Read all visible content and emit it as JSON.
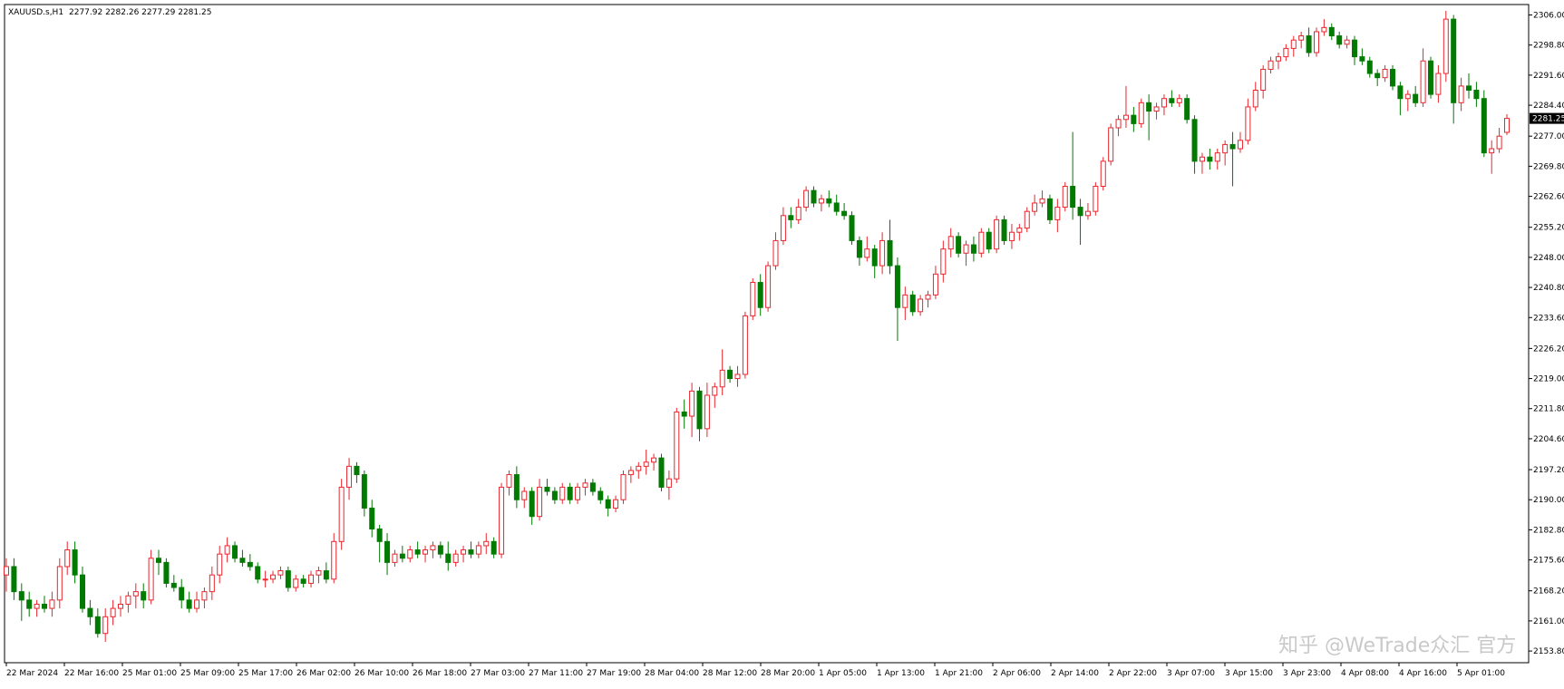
{
  "header": {
    "symbol": "XAUUSD.s,H1",
    "ohlc": "2277.92 2282.26 2277.29 2281.25"
  },
  "price_tag": "2281.25",
  "watermark": "知乎 @WeTrade众汇 官方",
  "colors": {
    "up": "#e8262e",
    "down": "#007a00",
    "axis": "#000000",
    "tag_bg": "#000000",
    "tag_fg": "#ffffff"
  },
  "chart_data": {
    "type": "candlestick",
    "symbol": "XAUUSD.s",
    "timeframe": "H1",
    "ylim": [
      2151.0,
      2308.5
    ],
    "y_ticks": [
      "2306.00",
      "2298.80",
      "2291.60",
      "2284.40",
      "2277.00",
      "2269.80",
      "2262.60",
      "2255.20",
      "2248.00",
      "2240.80",
      "2233.60",
      "2226.20",
      "2219.00",
      "2211.80",
      "2204.60",
      "2197.20",
      "2190.00",
      "2182.80",
      "2175.60",
      "2168.20",
      "2161.00",
      "2153.80"
    ],
    "x_ticks": [
      "22 Mar 2024",
      "22 Mar 16:00",
      "25 Mar 01:00",
      "25 Mar 09:00",
      "25 Mar 17:00",
      "26 Mar 02:00",
      "26 Mar 10:00",
      "26 Mar 18:00",
      "27 Mar 03:00",
      "27 Mar 11:00",
      "27 Mar 19:00",
      "28 Mar 04:00",
      "28 Mar 12:00",
      "28 Mar 20:00",
      "1 Apr 05:00",
      "1 Apr 13:00",
      "1 Apr 21:00",
      "2 Apr 06:00",
      "2 Apr 14:00",
      "2 Apr 22:00",
      "3 Apr 07:00",
      "3 Apr 15:00",
      "3 Apr 23:00",
      "4 Apr 08:00",
      "4 Apr 16:00",
      "5 Apr 01:00"
    ],
    "candles": [
      {
        "o": 2172,
        "h": 2176,
        "l": 2168,
        "c": 2174
      },
      {
        "o": 2174,
        "h": 2176,
        "l": 2166,
        "c": 2168
      },
      {
        "o": 2168,
        "h": 2170,
        "l": 2161,
        "c": 2166
      },
      {
        "o": 2166,
        "h": 2168,
        "l": 2162,
        "c": 2164
      },
      {
        "o": 2164,
        "h": 2166,
        "l": 2162,
        "c": 2165
      },
      {
        "o": 2165,
        "h": 2167,
        "l": 2163,
        "c": 2164
      },
      {
        "o": 2164,
        "h": 2168,
        "l": 2162,
        "c": 2166
      },
      {
        "o": 2166,
        "h": 2176,
        "l": 2164,
        "c": 2174
      },
      {
        "o": 2174,
        "h": 2180,
        "l": 2172,
        "c": 2178
      },
      {
        "o": 2178,
        "h": 2180,
        "l": 2170,
        "c": 2172
      },
      {
        "o": 2172,
        "h": 2174,
        "l": 2163,
        "c": 2164
      },
      {
        "o": 2164,
        "h": 2166,
        "l": 2160,
        "c": 2162
      },
      {
        "o": 2162,
        "h": 2164,
        "l": 2157,
        "c": 2158
      },
      {
        "o": 2158,
        "h": 2164,
        "l": 2156,
        "c": 2162
      },
      {
        "o": 2162,
        "h": 2166,
        "l": 2160,
        "c": 2164
      },
      {
        "o": 2164,
        "h": 2167,
        "l": 2162,
        "c": 2165
      },
      {
        "o": 2165,
        "h": 2168,
        "l": 2163,
        "c": 2167
      },
      {
        "o": 2167,
        "h": 2170,
        "l": 2164,
        "c": 2168
      },
      {
        "o": 2168,
        "h": 2170,
        "l": 2164,
        "c": 2166
      },
      {
        "o": 2166,
        "h": 2178,
        "l": 2165,
        "c": 2176
      },
      {
        "o": 2176,
        "h": 2178,
        "l": 2172,
        "c": 2175
      },
      {
        "o": 2175,
        "h": 2176,
        "l": 2169,
        "c": 2170
      },
      {
        "o": 2170,
        "h": 2172,
        "l": 2168,
        "c": 2169
      },
      {
        "o": 2169,
        "h": 2171,
        "l": 2164,
        "c": 2166
      },
      {
        "o": 2166,
        "h": 2168,
        "l": 2163,
        "c": 2164
      },
      {
        "o": 2164,
        "h": 2168,
        "l": 2163,
        "c": 2166
      },
      {
        "o": 2166,
        "h": 2169,
        "l": 2164,
        "c": 2168
      },
      {
        "o": 2168,
        "h": 2174,
        "l": 2166,
        "c": 2172
      },
      {
        "o": 2172,
        "h": 2179,
        "l": 2170,
        "c": 2177
      },
      {
        "o": 2177,
        "h": 2181,
        "l": 2175,
        "c": 2179
      },
      {
        "o": 2179,
        "h": 2180,
        "l": 2175,
        "c": 2176
      },
      {
        "o": 2176,
        "h": 2178,
        "l": 2174,
        "c": 2175
      },
      {
        "o": 2175,
        "h": 2177,
        "l": 2173,
        "c": 2174
      },
      {
        "o": 2174,
        "h": 2175,
        "l": 2170,
        "c": 2171
      },
      {
        "o": 2171,
        "h": 2173,
        "l": 2169,
        "c": 2171
      },
      {
        "o": 2171,
        "h": 2173,
        "l": 2170,
        "c": 2172
      },
      {
        "o": 2172,
        "h": 2174,
        "l": 2171,
        "c": 2173
      },
      {
        "o": 2173,
        "h": 2174,
        "l": 2168,
        "c": 2169
      },
      {
        "o": 2169,
        "h": 2172,
        "l": 2168,
        "c": 2171
      },
      {
        "o": 2171,
        "h": 2172,
        "l": 2169,
        "c": 2170
      },
      {
        "o": 2170,
        "h": 2173,
        "l": 2169,
        "c": 2172
      },
      {
        "o": 2172,
        "h": 2174,
        "l": 2170,
        "c": 2173
      },
      {
        "o": 2173,
        "h": 2175,
        "l": 2170,
        "c": 2171
      },
      {
        "o": 2171,
        "h": 2182,
        "l": 2170,
        "c": 2180
      },
      {
        "o": 2180,
        "h": 2195,
        "l": 2178,
        "c": 2193
      },
      {
        "o": 2193,
        "h": 2200,
        "l": 2190,
        "c": 2198
      },
      {
        "o": 2198,
        "h": 2199,
        "l": 2194,
        "c": 2196
      },
      {
        "o": 2196,
        "h": 2197,
        "l": 2186,
        "c": 2188
      },
      {
        "o": 2188,
        "h": 2190,
        "l": 2181,
        "c": 2183
      },
      {
        "o": 2183,
        "h": 2184,
        "l": 2175,
        "c": 2180
      },
      {
        "o": 2180,
        "h": 2182,
        "l": 2172,
        "c": 2175
      },
      {
        "o": 2175,
        "h": 2178,
        "l": 2174,
        "c": 2177
      },
      {
        "o": 2177,
        "h": 2179,
        "l": 2175,
        "c": 2176
      },
      {
        "o": 2176,
        "h": 2179,
        "l": 2175,
        "c": 2178
      },
      {
        "o": 2178,
        "h": 2180,
        "l": 2176,
        "c": 2177
      },
      {
        "o": 2177,
        "h": 2179,
        "l": 2175,
        "c": 2178
      },
      {
        "o": 2178,
        "h": 2180,
        "l": 2176,
        "c": 2179
      },
      {
        "o": 2179,
        "h": 2180,
        "l": 2176,
        "c": 2177
      },
      {
        "o": 2177,
        "h": 2180,
        "l": 2173,
        "c": 2175
      },
      {
        "o": 2175,
        "h": 2178,
        "l": 2174,
        "c": 2177
      },
      {
        "o": 2177,
        "h": 2179,
        "l": 2175,
        "c": 2178
      },
      {
        "o": 2178,
        "h": 2180,
        "l": 2176,
        "c": 2177
      },
      {
        "o": 2177,
        "h": 2180,
        "l": 2176,
        "c": 2179
      },
      {
        "o": 2179,
        "h": 2182,
        "l": 2177,
        "c": 2180
      },
      {
        "o": 2180,
        "h": 2181,
        "l": 2176,
        "c": 2177
      },
      {
        "o": 2177,
        "h": 2194,
        "l": 2176,
        "c": 2193
      },
      {
        "o": 2193,
        "h": 2197,
        "l": 2191,
        "c": 2196
      },
      {
        "o": 2196,
        "h": 2198,
        "l": 2188,
        "c": 2190
      },
      {
        "o": 2190,
        "h": 2193,
        "l": 2188,
        "c": 2192
      },
      {
        "o": 2192,
        "h": 2193,
        "l": 2184,
        "c": 2186
      },
      {
        "o": 2186,
        "h": 2195,
        "l": 2185,
        "c": 2193
      },
      {
        "o": 2193,
        "h": 2195,
        "l": 2191,
        "c": 2192
      },
      {
        "o": 2192,
        "h": 2193,
        "l": 2189,
        "c": 2190
      },
      {
        "o": 2190,
        "h": 2194,
        "l": 2189,
        "c": 2193
      },
      {
        "o": 2193,
        "h": 2194,
        "l": 2189,
        "c": 2190
      },
      {
        "o": 2190,
        "h": 2194,
        "l": 2189,
        "c": 2193
      },
      {
        "o": 2193,
        "h": 2195,
        "l": 2191,
        "c": 2194
      },
      {
        "o": 2194,
        "h": 2195,
        "l": 2191,
        "c": 2192
      },
      {
        "o": 2192,
        "h": 2193,
        "l": 2189,
        "c": 2190
      },
      {
        "o": 2190,
        "h": 2191,
        "l": 2186,
        "c": 2188
      },
      {
        "o": 2188,
        "h": 2191,
        "l": 2187,
        "c": 2190
      },
      {
        "o": 2190,
        "h": 2197,
        "l": 2189,
        "c": 2196
      },
      {
        "o": 2196,
        "h": 2198,
        "l": 2194,
        "c": 2197
      },
      {
        "o": 2197,
        "h": 2199,
        "l": 2195,
        "c": 2198
      },
      {
        "o": 2198,
        "h": 2202,
        "l": 2196,
        "c": 2199
      },
      {
        "o": 2199,
        "h": 2201,
        "l": 2197,
        "c": 2200
      },
      {
        "o": 2200,
        "h": 2201,
        "l": 2192,
        "c": 2193
      },
      {
        "o": 2193,
        "h": 2197,
        "l": 2190,
        "c": 2195
      },
      {
        "o": 2195,
        "h": 2212,
        "l": 2194,
        "c": 2211
      },
      {
        "o": 2211,
        "h": 2214,
        "l": 2207,
        "c": 2210
      },
      {
        "o": 2210,
        "h": 2218,
        "l": 2205,
        "c": 2216
      },
      {
        "o": 2216,
        "h": 2217,
        "l": 2204,
        "c": 2207
      },
      {
        "o": 2207,
        "h": 2218,
        "l": 2205,
        "c": 2215
      },
      {
        "o": 2215,
        "h": 2218,
        "l": 2212,
        "c": 2217
      },
      {
        "o": 2217,
        "h": 2226,
        "l": 2215,
        "c": 2221
      },
      {
        "o": 2221,
        "h": 2222,
        "l": 2218,
        "c": 2219
      },
      {
        "o": 2219,
        "h": 2222,
        "l": 2217,
        "c": 2220
      },
      {
        "o": 2220,
        "h": 2235,
        "l": 2219,
        "c": 2234
      },
      {
        "o": 2234,
        "h": 2243,
        "l": 2233,
        "c": 2242
      },
      {
        "o": 2242,
        "h": 2244,
        "l": 2234,
        "c": 2236
      },
      {
        "o": 2236,
        "h": 2247,
        "l": 2235,
        "c": 2246
      },
      {
        "o": 2246,
        "h": 2254,
        "l": 2245,
        "c": 2252
      },
      {
        "o": 2252,
        "h": 2260,
        "l": 2251,
        "c": 2258
      },
      {
        "o": 2258,
        "h": 2260,
        "l": 2255,
        "c": 2257
      },
      {
        "o": 2257,
        "h": 2262,
        "l": 2256,
        "c": 2260
      },
      {
        "o": 2260,
        "h": 2265,
        "l": 2259,
        "c": 2264
      },
      {
        "o": 2264,
        "h": 2265,
        "l": 2260,
        "c": 2261
      },
      {
        "o": 2261,
        "h": 2263,
        "l": 2259,
        "c": 2262
      },
      {
        "o": 2262,
        "h": 2264,
        "l": 2260,
        "c": 2261
      },
      {
        "o": 2261,
        "h": 2263,
        "l": 2258,
        "c": 2259
      },
      {
        "o": 2259,
        "h": 2261,
        "l": 2257,
        "c": 2258
      },
      {
        "o": 2258,
        "h": 2259,
        "l": 2251,
        "c": 2252
      },
      {
        "o": 2252,
        "h": 2253,
        "l": 2246,
        "c": 2248
      },
      {
        "o": 2248,
        "h": 2253,
        "l": 2247,
        "c": 2250
      },
      {
        "o": 2250,
        "h": 2251,
        "l": 2243,
        "c": 2246
      },
      {
        "o": 2246,
        "h": 2254,
        "l": 2244,
        "c": 2252
      },
      {
        "o": 2252,
        "h": 2257,
        "l": 2244,
        "c": 2246
      },
      {
        "o": 2246,
        "h": 2248,
        "l": 2228,
        "c": 2236
      },
      {
        "o": 2236,
        "h": 2241,
        "l": 2233,
        "c": 2239
      },
      {
        "o": 2239,
        "h": 2240,
        "l": 2234,
        "c": 2235
      },
      {
        "o": 2235,
        "h": 2239,
        "l": 2234,
        "c": 2238
      },
      {
        "o": 2238,
        "h": 2240,
        "l": 2236,
        "c": 2239
      },
      {
        "o": 2239,
        "h": 2246,
        "l": 2238,
        "c": 2244
      },
      {
        "o": 2244,
        "h": 2252,
        "l": 2242,
        "c": 2250
      },
      {
        "o": 2250,
        "h": 2255,
        "l": 2248,
        "c": 2253
      },
      {
        "o": 2253,
        "h": 2254,
        "l": 2248,
        "c": 2249
      },
      {
        "o": 2249,
        "h": 2252,
        "l": 2246,
        "c": 2251
      },
      {
        "o": 2251,
        "h": 2253,
        "l": 2247,
        "c": 2249
      },
      {
        "o": 2249,
        "h": 2255,
        "l": 2248,
        "c": 2254
      },
      {
        "o": 2254,
        "h": 2255,
        "l": 2249,
        "c": 2250
      },
      {
        "o": 2250,
        "h": 2258,
        "l": 2249,
        "c": 2257
      },
      {
        "o": 2257,
        "h": 2258,
        "l": 2251,
        "c": 2252
      },
      {
        "o": 2252,
        "h": 2256,
        "l": 2250,
        "c": 2254
      },
      {
        "o": 2254,
        "h": 2256,
        "l": 2252,
        "c": 2255
      },
      {
        "o": 2255,
        "h": 2260,
        "l": 2254,
        "c": 2259
      },
      {
        "o": 2259,
        "h": 2263,
        "l": 2258,
        "c": 2261
      },
      {
        "o": 2261,
        "h": 2264,
        "l": 2260,
        "c": 2262
      },
      {
        "o": 2262,
        "h": 2263,
        "l": 2256,
        "c": 2257
      },
      {
        "o": 2257,
        "h": 2262,
        "l": 2254,
        "c": 2260
      },
      {
        "o": 2260,
        "h": 2266,
        "l": 2259,
        "c": 2265
      },
      {
        "o": 2265,
        "h": 2278,
        "l": 2257,
        "c": 2260
      },
      {
        "o": 2260,
        "h": 2262,
        "l": 2251,
        "c": 2258
      },
      {
        "o": 2258,
        "h": 2261,
        "l": 2257,
        "c": 2259
      },
      {
        "o": 2259,
        "h": 2266,
        "l": 2258,
        "c": 2265
      },
      {
        "o": 2265,
        "h": 2272,
        "l": 2264,
        "c": 2271
      },
      {
        "o": 2271,
        "h": 2280,
        "l": 2270,
        "c": 2279
      },
      {
        "o": 2279,
        "h": 2282,
        "l": 2277,
        "c": 2281
      },
      {
        "o": 2281,
        "h": 2289,
        "l": 2279,
        "c": 2282
      },
      {
        "o": 2282,
        "h": 2284,
        "l": 2278,
        "c": 2280
      },
      {
        "o": 2280,
        "h": 2286,
        "l": 2279,
        "c": 2285
      },
      {
        "o": 2285,
        "h": 2287,
        "l": 2276,
        "c": 2283
      },
      {
        "o": 2283,
        "h": 2285,
        "l": 2281,
        "c": 2284
      },
      {
        "o": 2284,
        "h": 2287,
        "l": 2282,
        "c": 2286
      },
      {
        "o": 2286,
        "h": 2288,
        "l": 2284,
        "c": 2285
      },
      {
        "o": 2285,
        "h": 2287,
        "l": 2284,
        "c": 2286
      },
      {
        "o": 2286,
        "h": 2287,
        "l": 2280,
        "c": 2281
      },
      {
        "o": 2281,
        "h": 2282,
        "l": 2268,
        "c": 2271
      },
      {
        "o": 2271,
        "h": 2273,
        "l": 2268,
        "c": 2272
      },
      {
        "o": 2272,
        "h": 2274,
        "l": 2269,
        "c": 2271
      },
      {
        "o": 2271,
        "h": 2274,
        "l": 2269,
        "c": 2273
      },
      {
        "o": 2273,
        "h": 2276,
        "l": 2270,
        "c": 2275
      },
      {
        "o": 2275,
        "h": 2278,
        "l": 2265,
        "c": 2274
      },
      {
        "o": 2274,
        "h": 2278,
        "l": 2273,
        "c": 2276
      },
      {
        "o": 2276,
        "h": 2286,
        "l": 2275,
        "c": 2284
      },
      {
        "o": 2284,
        "h": 2290,
        "l": 2283,
        "c": 2288
      },
      {
        "o": 2288,
        "h": 2294,
        "l": 2286,
        "c": 2293
      },
      {
        "o": 2293,
        "h": 2296,
        "l": 2292,
        "c": 2295
      },
      {
        "o": 2295,
        "h": 2297,
        "l": 2293,
        "c": 2296
      },
      {
        "o": 2296,
        "h": 2299,
        "l": 2295,
        "c": 2298
      },
      {
        "o": 2298,
        "h": 2301,
        "l": 2296,
        "c": 2300
      },
      {
        "o": 2300,
        "h": 2302,
        "l": 2298,
        "c": 2301
      },
      {
        "o": 2301,
        "h": 2303,
        "l": 2296,
        "c": 2297
      },
      {
        "o": 2297,
        "h": 2303,
        "l": 2296,
        "c": 2302
      },
      {
        "o": 2302,
        "h": 2305,
        "l": 2301,
        "c": 2303
      },
      {
        "o": 2303,
        "h": 2304,
        "l": 2300,
        "c": 2301
      },
      {
        "o": 2301,
        "h": 2302,
        "l": 2298,
        "c": 2299
      },
      {
        "o": 2299,
        "h": 2301,
        "l": 2298,
        "c": 2300
      },
      {
        "o": 2300,
        "h": 2301,
        "l": 2294,
        "c": 2296
      },
      {
        "o": 2296,
        "h": 2298,
        "l": 2294,
        "c": 2295
      },
      {
        "o": 2295,
        "h": 2296,
        "l": 2291,
        "c": 2292
      },
      {
        "o": 2292,
        "h": 2293,
        "l": 2289,
        "c": 2291
      },
      {
        "o": 2291,
        "h": 2294,
        "l": 2290,
        "c": 2293
      },
      {
        "o": 2293,
        "h": 2294,
        "l": 2288,
        "c": 2289
      },
      {
        "o": 2289,
        "h": 2290,
        "l": 2282,
        "c": 2286
      },
      {
        "o": 2286,
        "h": 2288,
        "l": 2283,
        "c": 2287
      },
      {
        "o": 2287,
        "h": 2289,
        "l": 2284,
        "c": 2285
      },
      {
        "o": 2285,
        "h": 2298,
        "l": 2284,
        "c": 2295
      },
      {
        "o": 2295,
        "h": 2296,
        "l": 2286,
        "c": 2287
      },
      {
        "o": 2287,
        "h": 2294,
        "l": 2285,
        "c": 2292
      },
      {
        "o": 2292,
        "h": 2307,
        "l": 2290,
        "c": 2305
      },
      {
        "o": 2305,
        "h": 2306,
        "l": 2280,
        "c": 2285
      },
      {
        "o": 2285,
        "h": 2291,
        "l": 2283,
        "c": 2289
      },
      {
        "o": 2289,
        "h": 2292,
        "l": 2286,
        "c": 2288
      },
      {
        "o": 2288,
        "h": 2290,
        "l": 2284,
        "c": 2286
      },
      {
        "o": 2286,
        "h": 2288,
        "l": 2272,
        "c": 2273
      },
      {
        "o": 2273,
        "h": 2276,
        "l": 2268,
        "c": 2274
      },
      {
        "o": 2274,
        "h": 2279,
        "l": 2273,
        "c": 2277
      },
      {
        "o": 2277.92,
        "h": 2282.26,
        "l": 2277.29,
        "c": 2281.25
      }
    ]
  }
}
